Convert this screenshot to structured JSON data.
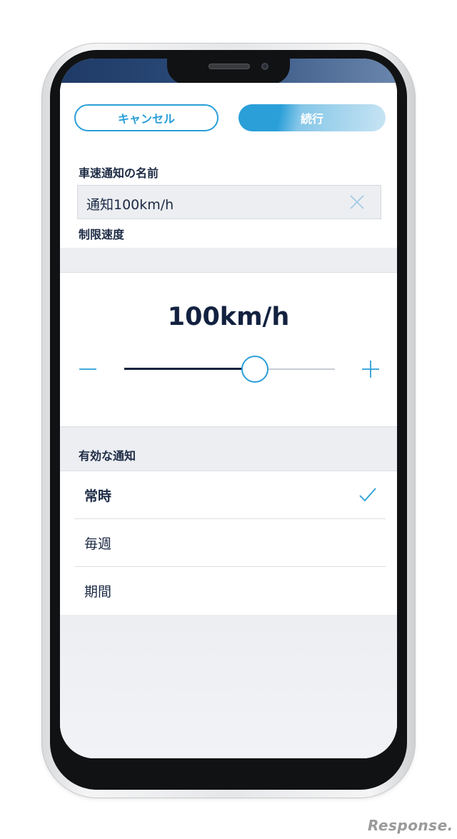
{
  "header": {
    "cancel_label": "キャンセル",
    "continue_label": "続行"
  },
  "name_section": {
    "label": "車速通知の名前",
    "value": "通知100km/h"
  },
  "speed_section": {
    "label": "制限速度",
    "value_text": "100km/h",
    "slider_fraction": 0.62
  },
  "notification_section": {
    "label": "有効な通知",
    "options": [
      {
        "label": "常時",
        "selected": true
      },
      {
        "label": "毎週",
        "selected": false
      },
      {
        "label": "期間",
        "selected": false
      }
    ]
  },
  "watermark": "Response.",
  "colors": {
    "accent": "#2a9fd8",
    "text_dark": "#12213f",
    "background": "#eceef2"
  },
  "icons": {
    "clear": "close-icon",
    "minus": "minus-icon",
    "plus": "plus-icon",
    "check": "checkmark-icon"
  }
}
